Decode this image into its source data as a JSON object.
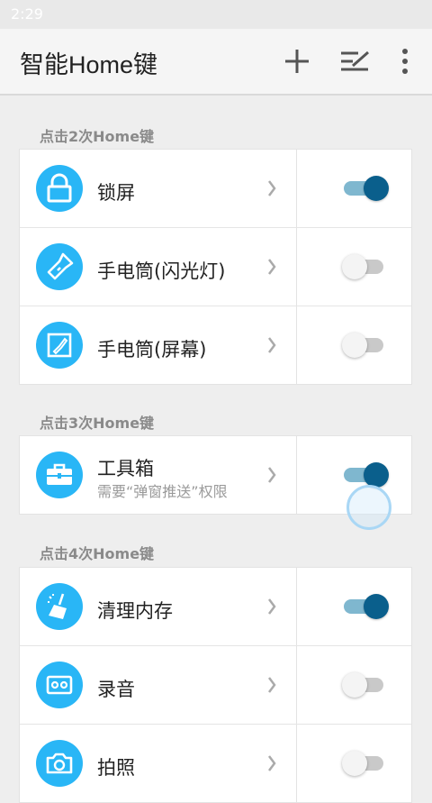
{
  "status_bar": {
    "time": "2:29"
  },
  "app_bar": {
    "title": "智能Home键",
    "actions": [
      "add-icon",
      "edit-list-icon",
      "more-vert-icon"
    ]
  },
  "sections": [
    {
      "header": "点击2次Home键",
      "items": [
        {
          "label": "锁屏",
          "icon": "lock-icon",
          "enabled": true
        },
        {
          "label": "手电筒(闪光灯)",
          "icon": "flashlight-icon",
          "enabled": false
        },
        {
          "label": "手电筒(屏幕)",
          "icon": "screen-light-icon",
          "enabled": false
        }
      ]
    },
    {
      "header": "点击3次Home键",
      "items": [
        {
          "label": "工具箱",
          "sublabel": "需要“弹窗推送”权限",
          "icon": "toolbox-icon",
          "enabled": true
        }
      ]
    },
    {
      "header": "点击4次Home键",
      "items": [
        {
          "label": "清理内存",
          "icon": "broom-icon",
          "enabled": true
        },
        {
          "label": "录音",
          "icon": "recorder-icon",
          "enabled": false
        },
        {
          "label": "拍照",
          "icon": "camera-icon",
          "enabled": false
        }
      ]
    }
  ],
  "colors": {
    "icon_bg": "#29b6f6",
    "toggle_on_thumb": "#0a5f8c",
    "toggle_on_track": "#7fb7cf",
    "toggle_off_track": "#c9c9c9"
  }
}
